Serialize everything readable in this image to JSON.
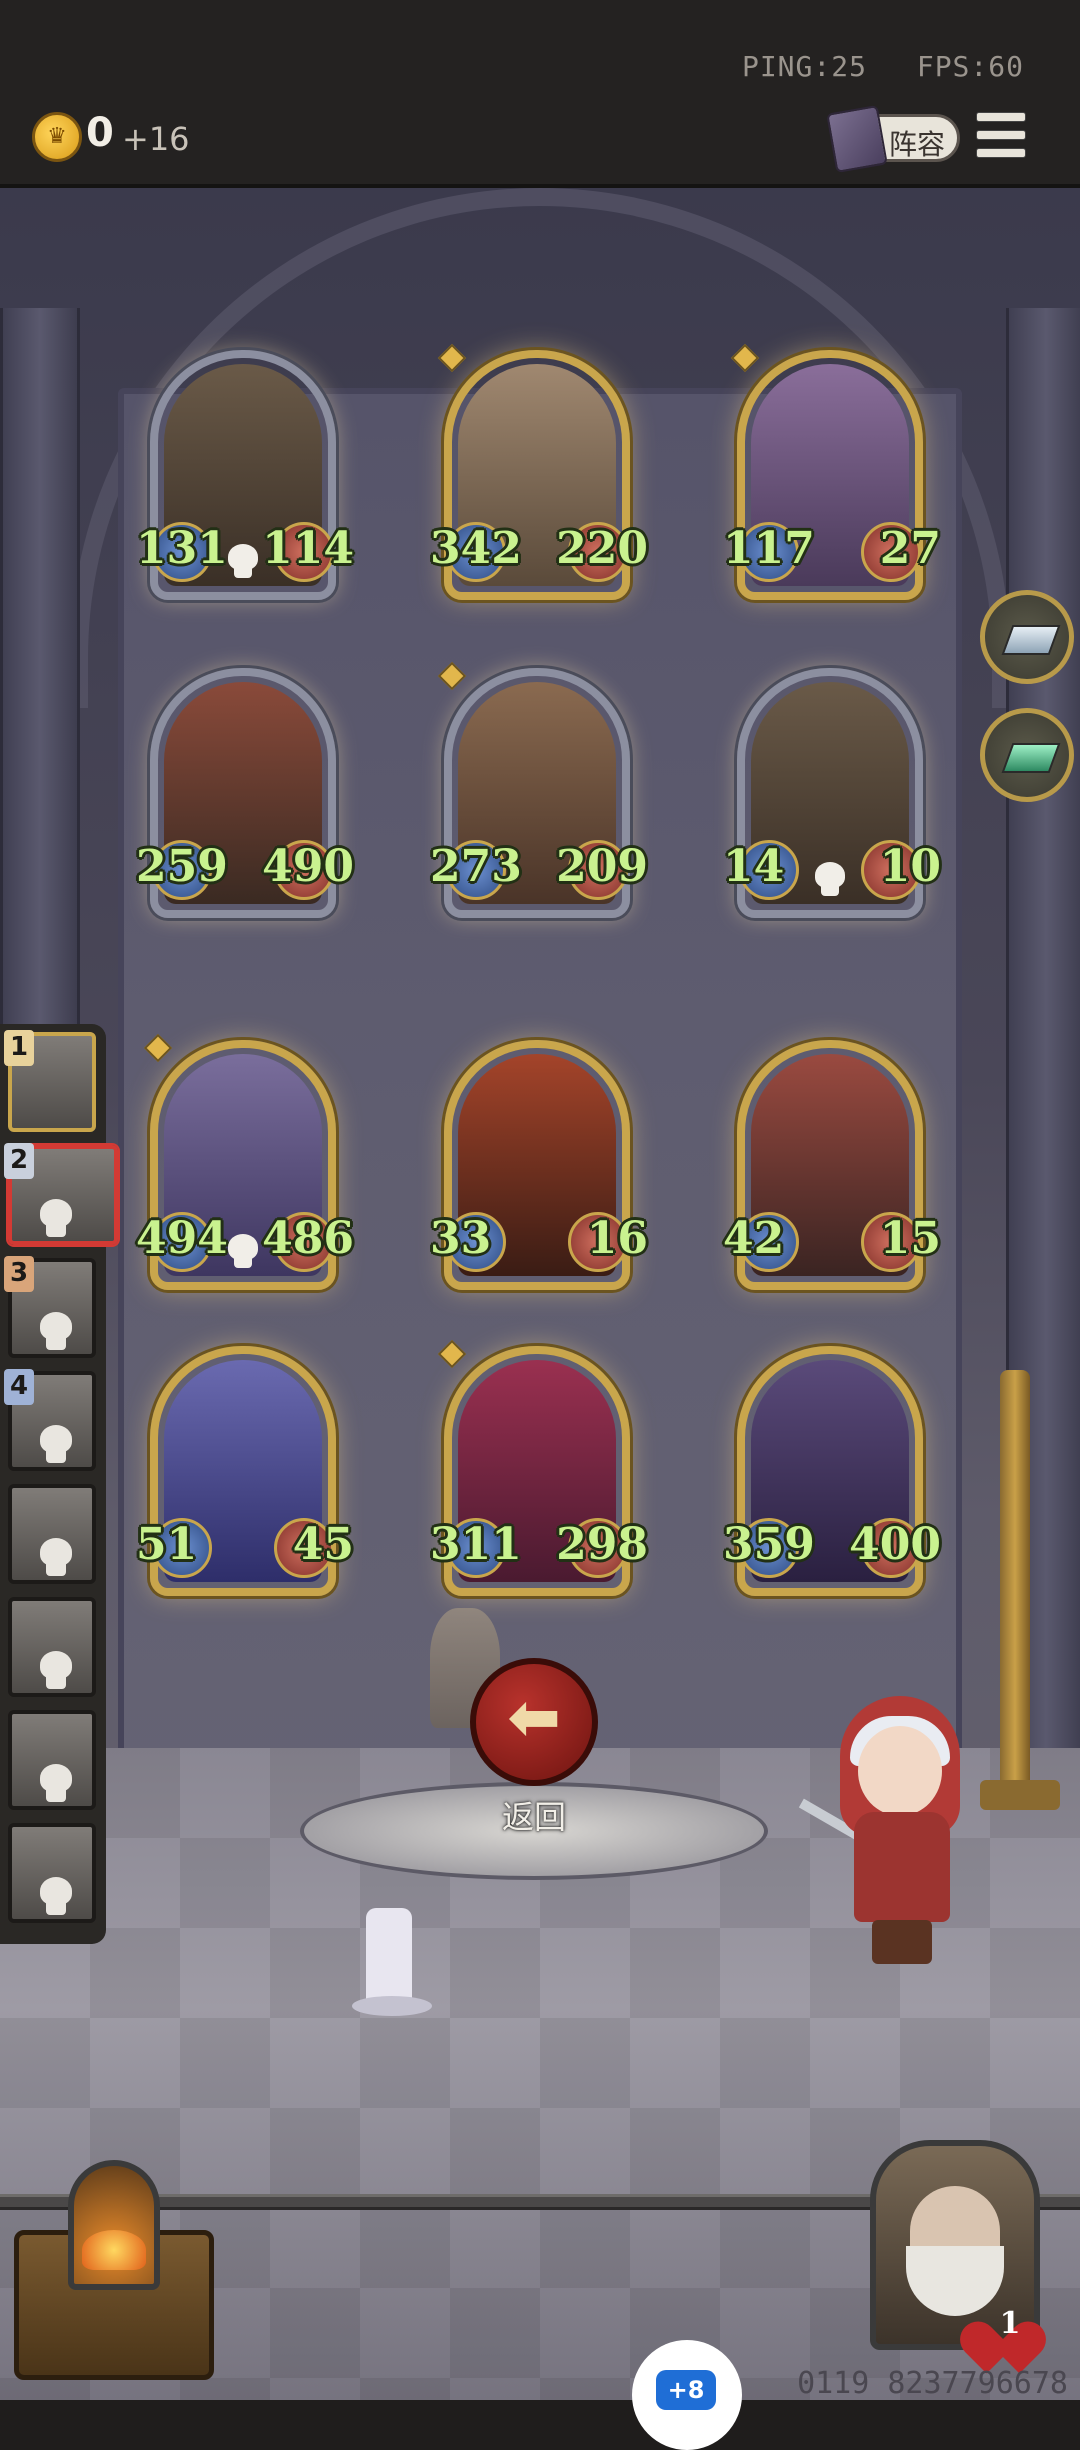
{
  "status": {
    "ping": "PING:25",
    "fps": "FPS:60"
  },
  "currency": {
    "icon": "crown-coin-icon",
    "value": "0",
    "bonus": "+16"
  },
  "roster_button": {
    "label": "阵容",
    "icon": "book-icon"
  },
  "menu_icon": "hamburger-menu-icon",
  "board": {
    "enemy_rows": [
      [
        {
          "atk": "131",
          "hp": "114",
          "skull": true,
          "frame": "grey",
          "gem": false
        },
        {
          "atk": "342",
          "hp": "220",
          "skull": false,
          "frame": "gold",
          "gem": true
        },
        {
          "atk": "117",
          "hp": "27",
          "skull": false,
          "frame": "gold",
          "gem": true
        }
      ],
      [
        {
          "atk": "259",
          "hp": "490",
          "skull": false,
          "frame": "grey",
          "gem": false
        },
        {
          "atk": "273",
          "hp": "209",
          "skull": false,
          "frame": "grey",
          "gem": true
        },
        {
          "atk": "14",
          "hp": "10",
          "skull": true,
          "frame": "grey",
          "gem": false
        }
      ]
    ],
    "player_rows": [
      [
        {
          "atk": "494",
          "hp": "486",
          "skull": true,
          "frame": "gold",
          "gem": true
        },
        {
          "atk": "33",
          "hp": "16",
          "skull": false,
          "frame": "gold",
          "gem": false
        },
        {
          "atk": "42",
          "hp": "15",
          "skull": false,
          "frame": "gold",
          "gem": false
        }
      ],
      [
        {
          "atk": "51",
          "hp": "45",
          "skull": false,
          "frame": "gold",
          "gem": false
        },
        {
          "atk": "311",
          "hp": "298",
          "skull": false,
          "frame": "gold",
          "gem": true
        },
        {
          "atk": "359",
          "hp": "400",
          "skull": false,
          "frame": "gold",
          "gem": false
        }
      ]
    ]
  },
  "side_items": [
    {
      "icon": "silver-ingot-icon"
    },
    {
      "icon": "green-ingot-icon"
    }
  ],
  "opponents": [
    {
      "rank": "1",
      "skull": false,
      "selected": false,
      "badge": "gold"
    },
    {
      "rank": "2",
      "skull": true,
      "selected": true,
      "badge": "silver"
    },
    {
      "rank": "3",
      "skull": true,
      "selected": false,
      "badge": "bronze"
    },
    {
      "rank": "4",
      "skull": true,
      "selected": false,
      "badge": "blue"
    },
    {
      "rank": "",
      "skull": true,
      "selected": false,
      "badge": ""
    },
    {
      "rank": "",
      "skull": true,
      "selected": false,
      "badge": ""
    },
    {
      "rank": "",
      "skull": true,
      "selected": false,
      "badge": ""
    },
    {
      "rank": "",
      "skull": true,
      "selected": false,
      "badge": ""
    }
  ],
  "return_button": {
    "label": "返回",
    "icon": "left-arrow-icon"
  },
  "boss": {
    "hp": "1"
  },
  "player_id": "0119 8237796678",
  "chat_badge": "+8",
  "colors": {
    "stat_text": "#c9f28f",
    "gold_frame": "#c9a64c",
    "grey_frame": "#8c8fa0",
    "selected": "#d33a34"
  }
}
